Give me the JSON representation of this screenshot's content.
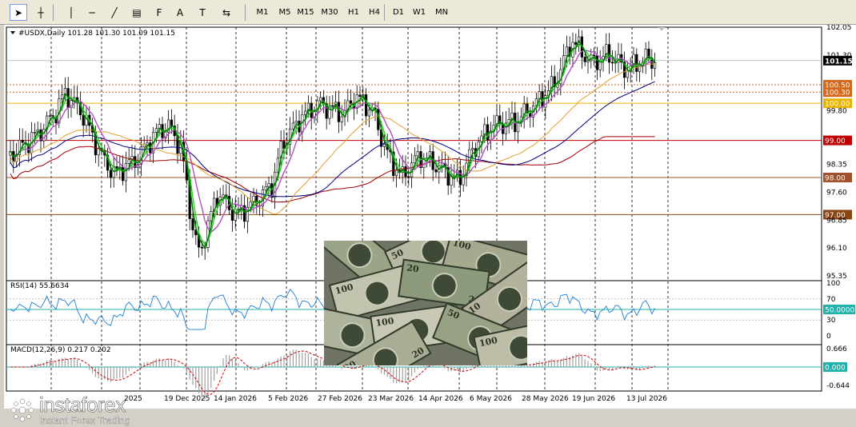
{
  "toolbar": {
    "tools": [
      {
        "name": "cursor-icon",
        "glyph": "➤"
      },
      {
        "name": "crosshair-icon",
        "glyph": "┼"
      },
      {
        "name": "vertical-line-icon",
        "glyph": "│"
      },
      {
        "name": "horizontal-line-icon",
        "glyph": "─"
      },
      {
        "name": "trend-line-icon",
        "glyph": "╱"
      },
      {
        "name": "channel-icon",
        "glyph": "▤"
      },
      {
        "name": "fibonacci-icon",
        "glyph": "F"
      },
      {
        "name": "text-icon",
        "glyph": "A"
      },
      {
        "name": "text-label-icon",
        "glyph": "T"
      },
      {
        "name": "arrows-icon",
        "glyph": "⇆"
      }
    ],
    "timeframes": [
      "M1",
      "M5",
      "M15",
      "M30",
      "H1",
      "H4",
      "D1",
      "W1",
      "MN"
    ]
  },
  "chart": {
    "header": "#USDX,Daily  101.28 101.30 101.09 101.15",
    "price_labels": [
      {
        "text": "102.05",
        "price": 102.05
      },
      {
        "text": "101.30",
        "price": 101.3
      },
      {
        "text": "99.80",
        "price": 99.8
      },
      {
        "text": "98.35",
        "price": 98.35
      },
      {
        "text": "97.60",
        "price": 97.6
      },
      {
        "text": "96.85",
        "price": 96.85
      },
      {
        "text": "96.10",
        "price": 96.1
      },
      {
        "text": "95.35",
        "price": 95.35
      }
    ],
    "current_price": {
      "text": "101.15",
      "price": 101.15,
      "color": "#000000"
    },
    "level_lines": [
      {
        "text": "100.50",
        "price": 100.5,
        "color": "#d2691e",
        "style": "dash"
      },
      {
        "text": "100.30",
        "price": 100.3,
        "color": "#d2691e",
        "style": "dash"
      },
      {
        "text": "100.00",
        "price": 100.0,
        "color": "#e8b400",
        "style": "solid"
      },
      {
        "text": "99.00",
        "price": 99.0,
        "color": "#c00000",
        "style": "solid"
      },
      {
        "text": "98.00",
        "price": 98.0,
        "color": "#a0522d",
        "style": "solid"
      },
      {
        "text": "97.00",
        "price": 97.0,
        "color": "#8b4513",
        "style": "solid"
      }
    ],
    "date_labels": [
      "2025",
      "19 Dec 2025",
      "14 Jan 2026",
      "5 Feb 2026",
      "27 Feb 2026",
      "23 Mar 2026",
      "14 Apr 2026",
      "6 May 2026",
      "28 May 2026",
      "19 Jun 2026",
      "13 Jul 2026"
    ],
    "rsi": {
      "label": "RSI(14) 55.6634",
      "ticks": [
        "100",
        "70",
        "30",
        "0"
      ],
      "tick_values": [
        100,
        70,
        30,
        0
      ],
      "marker": "50.0000"
    },
    "macd": {
      "label": "MACD(12,26,9) 0.217 0.202",
      "ticks": [
        "0.666",
        "-0.644"
      ],
      "tick_values": [
        0.666,
        -0.644
      ],
      "marker": "0.000"
    },
    "colors": {
      "candle": "#000000",
      "ma_fast": "#008000",
      "ma_green_light": "#32cd32",
      "ma_violet": "#b050c0",
      "ma_orange": "#e0a030",
      "ma_navy": "#000080",
      "ma_red": "#a00000",
      "rsi_line": "#1e7fd0",
      "rsi_level": "#20b2aa",
      "macd_hist": "#a0a0a0",
      "macd_signal": "#d00000",
      "grid": "#000000"
    }
  },
  "chart_data": {
    "type": "candlestick",
    "symbol": "#USDX",
    "timeframe": "Daily",
    "ohlc_last": {
      "open": 101.28,
      "high": 101.3,
      "low": 101.09,
      "close": 101.15
    },
    "ylim": [
      95.35,
      102.05
    ],
    "close_path": [
      [
        "2025-11-14",
        98.6
      ],
      [
        "2025-11-25",
        99.2
      ],
      [
        "2025-12-02",
        99.8
      ],
      [
        "2025-12-05",
        100.3
      ],
      [
        "2025-12-12",
        99.7
      ],
      [
        "2025-12-19",
        98.6
      ],
      [
        "2025-12-24",
        98.1
      ],
      [
        "2026-01-02",
        98.5
      ],
      [
        "2026-01-09",
        99.2
      ],
      [
        "2026-01-14",
        99.4
      ],
      [
        "2026-01-19",
        98.8
      ],
      [
        "2026-01-23",
        96.8
      ],
      [
        "2026-01-26",
        95.9
      ],
      [
        "2026-02-02",
        97.6
      ],
      [
        "2026-02-09",
        97.0
      ],
      [
        "2026-02-16",
        97.3
      ],
      [
        "2026-02-23",
        97.8
      ],
      [
        "2026-02-27",
        98.9
      ],
      [
        "2026-03-06",
        99.6
      ],
      [
        "2026-03-13",
        100.0
      ],
      [
        "2026-03-23",
        99.7
      ],
      [
        "2026-03-27",
        100.2
      ],
      [
        "2026-04-03",
        99.8
      ],
      [
        "2026-04-08",
        98.7
      ],
      [
        "2026-04-14",
        98.0
      ],
      [
        "2026-04-21",
        98.6
      ],
      [
        "2026-04-28",
        98.3
      ],
      [
        "2026-05-06",
        97.9
      ],
      [
        "2026-05-12",
        98.8
      ],
      [
        "2026-05-19",
        99.4
      ],
      [
        "2026-05-28",
        99.5
      ],
      [
        "2026-06-05",
        100.0
      ],
      [
        "2026-06-12",
        100.5
      ],
      [
        "2026-06-19",
        101.7
      ],
      [
        "2026-06-26",
        101.1
      ],
      [
        "2026-07-03",
        101.3
      ],
      [
        "2026-07-10",
        100.9
      ],
      [
        "2026-07-17",
        101.2
      ],
      [
        "2026-07-21",
        101.15
      ]
    ]
  }
}
